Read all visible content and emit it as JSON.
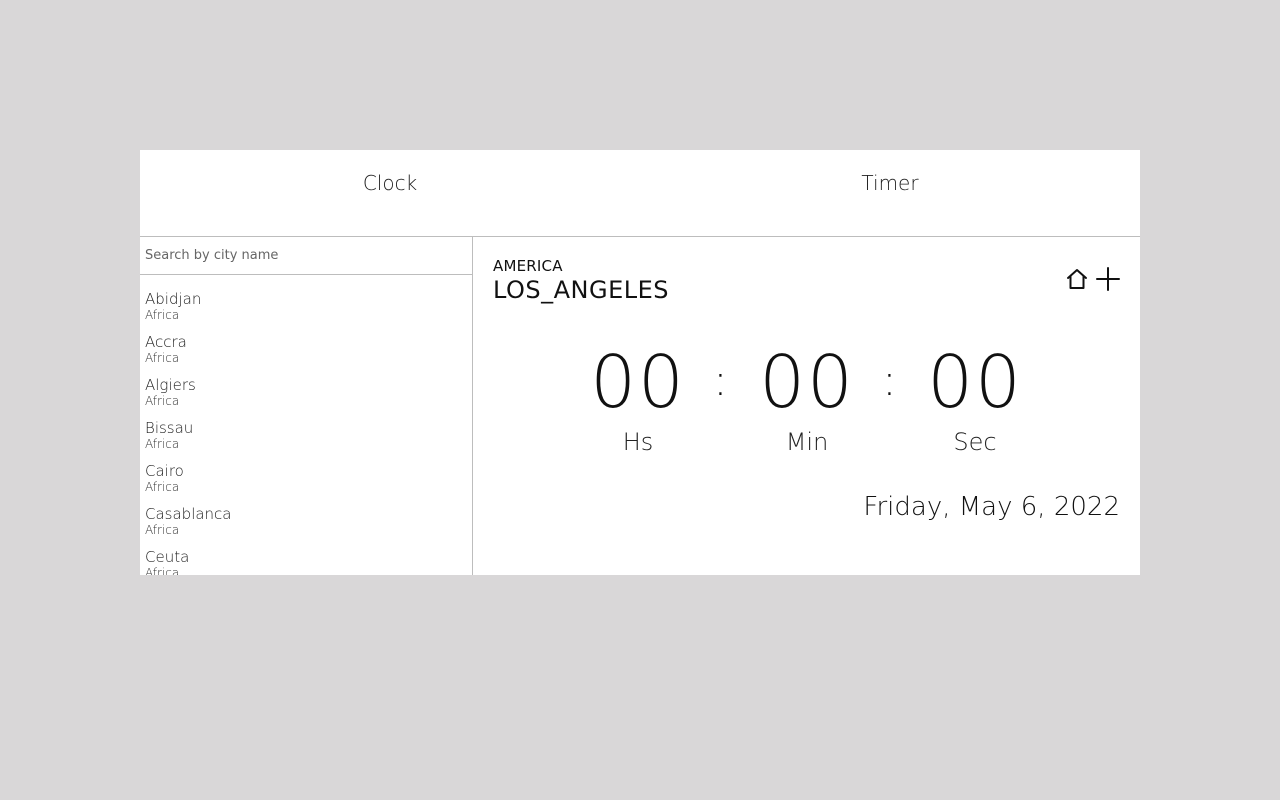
{
  "tabs": [
    {
      "label": "Clock"
    },
    {
      "label": "Timer"
    }
  ],
  "sidebar": {
    "search_placeholder": "Search by city name",
    "cities": [
      {
        "name": "Abidjan",
        "region": "Africa"
      },
      {
        "name": "Accra",
        "region": "Africa"
      },
      {
        "name": "Algiers",
        "region": "Africa"
      },
      {
        "name": "Bissau",
        "region": "Africa"
      },
      {
        "name": "Cairo",
        "region": "Africa"
      },
      {
        "name": "Casablanca",
        "region": "Africa"
      },
      {
        "name": "Ceuta",
        "region": "Africa"
      }
    ]
  },
  "main": {
    "region": "AMERICA",
    "city": "LOS_ANGELES",
    "icons": {
      "home": "home-icon",
      "add": "plus-icon"
    },
    "time": {
      "hours": "00",
      "minutes": "00",
      "seconds": "00",
      "separator": ":",
      "hours_label": "Hs",
      "minutes_label": "Min",
      "seconds_label": "Sec"
    },
    "date": "Friday, May 6, 2022"
  }
}
